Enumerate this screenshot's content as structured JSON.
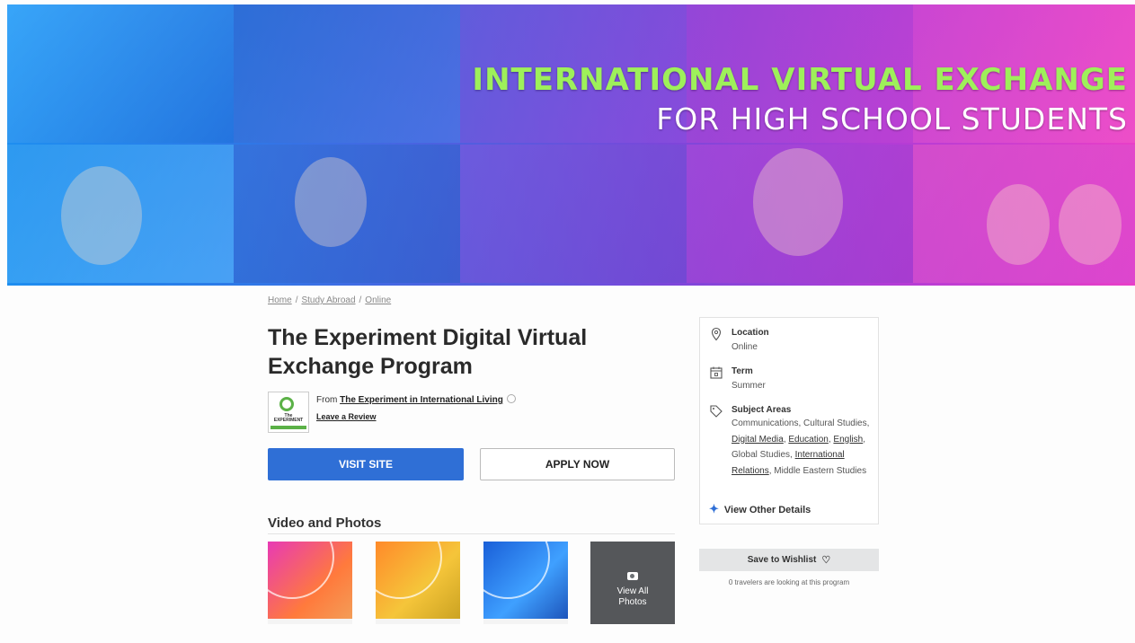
{
  "hero": {
    "line1": "INTERNATIONAL VIRTUAL EXCHANGE",
    "line2": "FOR HIGH SCHOOL STUDENTS"
  },
  "breadcrumb": {
    "items": [
      "Home",
      "Study Abroad",
      "Online"
    ],
    "separator": "/"
  },
  "program": {
    "title": "The Experiment Digital Virtual Exchange Program",
    "from_prefix": "From",
    "provider_name": "The Experiment in International Living",
    "review_link": "Leave a Review",
    "logo_text": "The EXPERIMENT"
  },
  "buttons": {
    "visit": "VISIT SITE",
    "apply": "APPLY NOW"
  },
  "media": {
    "section_title": "Video and Photos",
    "view_all_line1": "View All",
    "view_all_line2": "Photos"
  },
  "details": {
    "location_label": "Location",
    "location_value": "Online",
    "term_label": "Term",
    "term_value": "Summer",
    "subjects_label": "Subject Areas",
    "subjects": {
      "s1": "Communications, Cultural Studies,",
      "s2": "Digital Media",
      "s3": "Education",
      "s4": "English",
      "s5": "Global Studies,",
      "s6": "International Relations",
      "s7": "Middle Eastern Studies"
    },
    "view_other": "View Other Details"
  },
  "wishlist": {
    "label": "Save to Wishlist",
    "travelers": "0 travelers are looking at this program"
  },
  "colors": {
    "primary_button": "#2f6fd6",
    "hero_green": "#9ef05a",
    "logo_green": "#5bb147"
  }
}
